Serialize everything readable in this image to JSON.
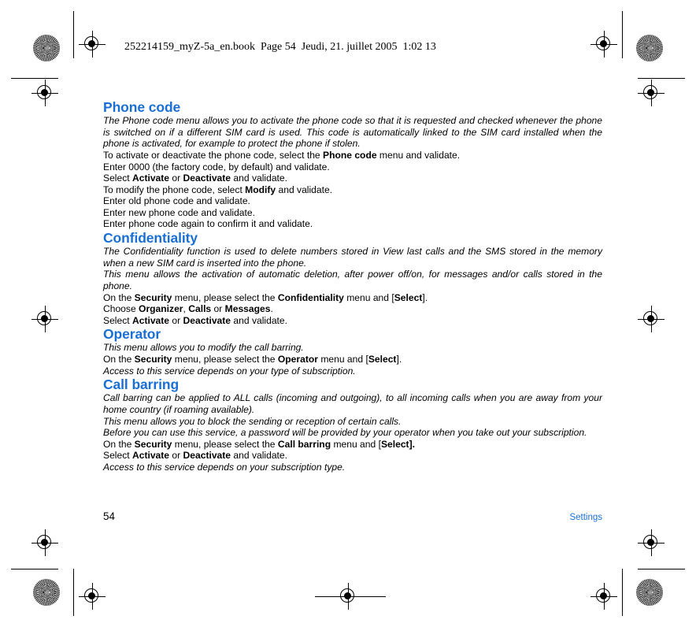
{
  "document": {
    "file_header": "252214159_myZ-5a_en.book  Page 54  Jeudi, 21. juillet 2005  1:02 13",
    "footer": {
      "page_number": "54",
      "chapter": "Settings"
    },
    "heading_color": "#1a6fd4"
  },
  "sections": [
    {
      "title": "Phone code",
      "paragraphs": [
        "The Phone code menu allows you to activate the phone code so that it is requested and checked whenever the phone is switched on if a different SIM card is used. This code is automatically linked to the SIM card installed when the phone is activated, for example to protect the phone if stolen.",
        "To activate or deactivate the phone code, select the Phone code menu and validate.",
        "Enter 0000 (the factory code, by default) and validate.",
        "Select Activate or Deactivate and validate.",
        "To modify the phone code, select Modify and validate.",
        "Enter old phone code and validate.",
        "Enter new phone code and validate.",
        "Enter phone code again to confirm it and validate."
      ]
    },
    {
      "title": "Confidentiality",
      "paragraphs": [
        "The Confidentiality function is used to delete numbers stored in View last calls and the SMS stored in the memory when a new SIM card is inserted into the phone.",
        "This menu allows the activation of automatic deletion, after power off/on, for messages and/or calls stored in the phone.",
        "On the Security menu, please select the Confidentiality menu and [Select].",
        "Choose Organizer, Calls or Messages.",
        "Select Activate or Deactivate and validate."
      ]
    },
    {
      "title": "Operator",
      "paragraphs": [
        "This menu allows you to modify the call barring.",
        "On the Security menu, please select the Operator menu and [Select].",
        "Access to this service depends on your type of subscription."
      ]
    },
    {
      "title": "Call barring",
      "paragraphs": [
        "Call barring can be applied to ALL calls (incoming and outgoing), to all incoming calls when you are away from your home country (if roaming available).",
        "This menu allows you to block the sending or reception of certain calls.",
        "Before you can use this service, a password will be provided by your operator when you take out your subscription.",
        "On the Security menu, please select the Call barring menu and [Select].",
        "Select Activate or Deactivate and validate.",
        "Access to this service depends on your subscription type."
      ]
    }
  ],
  "bold_terms": [
    "Phone code",
    "Activate",
    "Deactivate",
    "Modify",
    "Security",
    "Confidentiality",
    "Select",
    "Organizer",
    "Calls",
    "Messages",
    "Operator",
    "Call barring"
  ]
}
